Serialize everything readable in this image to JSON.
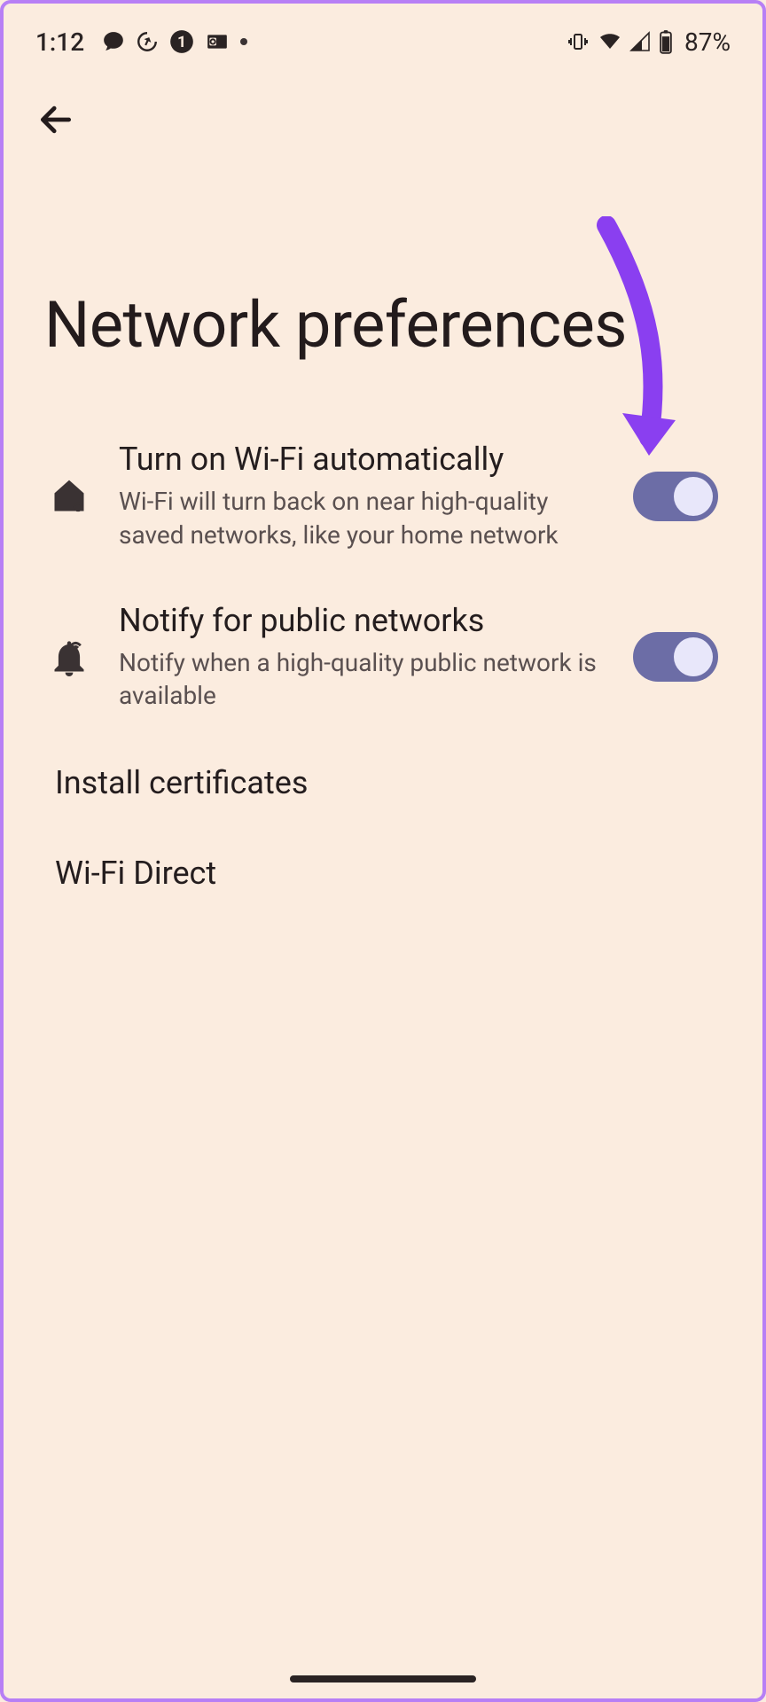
{
  "status": {
    "time": "1:12",
    "battery": "87%"
  },
  "page": {
    "title": "Network preferences"
  },
  "settings": {
    "auto_wifi": {
      "title": "Turn on Wi-Fi automatically",
      "subtitle": "Wi-Fi will turn back on near high-quality saved networks, like your home network",
      "enabled": true
    },
    "notify_public": {
      "title": "Notify for public networks",
      "subtitle": "Notify when a high-quality public network is available",
      "enabled": true
    },
    "install_certs": {
      "title": "Install certificates"
    },
    "wifi_direct": {
      "title": "Wi-Fi Direct"
    }
  },
  "colors": {
    "bg": "#fbecdf",
    "text_primary": "#241d1e",
    "text_secondary": "#5a5050",
    "toggle_track": "#6c6da6",
    "toggle_knob": "#e8e7fa",
    "annotation": "#8a3ff0",
    "border": "#b77ff5"
  }
}
